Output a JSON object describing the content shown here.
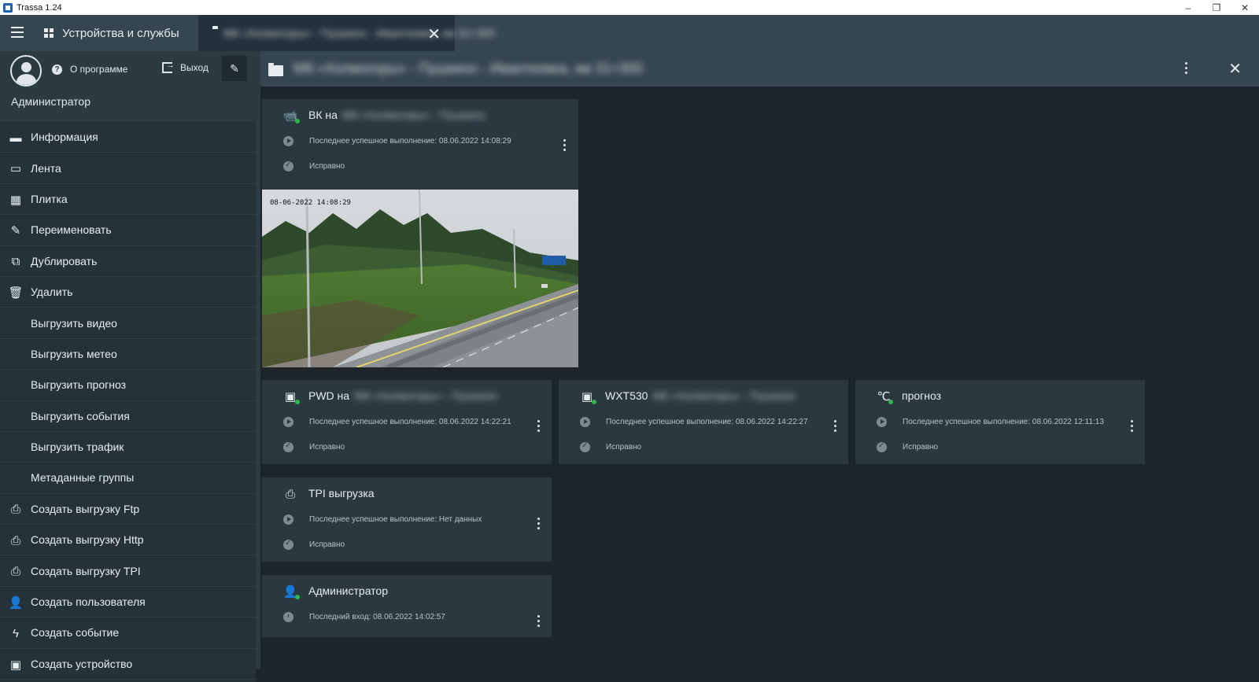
{
  "window": {
    "title": "Trassa 1.24",
    "controls": {
      "minimize": "–",
      "restore": "❐",
      "close": "✕"
    }
  },
  "tabs": {
    "menu_icon": "hamburger-icon",
    "devices_label": "Устройства и службы",
    "folder_label": "М8 «Холмогоры» - Пушкино - Ивантеевка, км 31+300",
    "close_glyph": "✕"
  },
  "sidebar": {
    "about_label": "О программе",
    "logout_label": "Выход",
    "pin_glyph": "✎",
    "username": "Администратор",
    "items": [
      {
        "label": "Информация",
        "icon": "folder-icon",
        "glyph": "▬"
      },
      {
        "label": "Лента",
        "icon": "list-icon",
        "glyph": "▭"
      },
      {
        "label": "Плитка",
        "icon": "tiles-icon",
        "glyph": "▦"
      },
      {
        "label": "Переименовать",
        "icon": "pencil-icon",
        "glyph": "✎"
      },
      {
        "label": "Дублировать",
        "icon": "duplicate-icon",
        "glyph": "⧉"
      },
      {
        "label": "Удалить",
        "icon": "trash-icon",
        "glyph": "🗑"
      },
      {
        "label": "Выгрузить видео",
        "icon": "",
        "glyph": ""
      },
      {
        "label": "Выгрузить метео",
        "icon": "",
        "glyph": ""
      },
      {
        "label": "Выгрузить прогноз",
        "icon": "",
        "glyph": ""
      },
      {
        "label": "Выгрузить события",
        "icon": "",
        "glyph": ""
      },
      {
        "label": "Выгрузить трафик",
        "icon": "",
        "glyph": ""
      },
      {
        "label": "Метаданные группы",
        "icon": "",
        "glyph": ""
      },
      {
        "label": "Создать выгрузку Ftp",
        "icon": "export-add-icon",
        "glyph": "⎙"
      },
      {
        "label": "Создать выгрузку Http",
        "icon": "export-add-icon",
        "glyph": "⎙"
      },
      {
        "label": "Создать выгрузку TPI",
        "icon": "export-add-icon",
        "glyph": "⎙"
      },
      {
        "label": "Создать пользователя",
        "icon": "user-add-icon",
        "glyph": "👤"
      },
      {
        "label": "Создать событие",
        "icon": "event-add-icon",
        "glyph": "ϟ"
      },
      {
        "label": "Создать устройство",
        "icon": "device-add-icon",
        "glyph": "▣"
      }
    ]
  },
  "content": {
    "header_title": "М8 «Холмогоры» - Пушкино - Ивантеевка, км 31+300",
    "cards": {
      "camera": {
        "title": "ВК на",
        "title_blurred": "М8 «Холмогоры» - Пушкино",
        "last_run": "Последнее успешное выполнение: 08.06.2022 14:08:29",
        "status": "Исправно",
        "image_timestamp": "08-06-2022 14:08:29"
      },
      "pwd": {
        "title": "PWD на",
        "title_blurred": "М8 «Холмогоры» - Пушкино",
        "last_run": "Последнее успешное выполнение: 08.06.2022 14:22:21",
        "status": "Исправно"
      },
      "wxt": {
        "title": "WXT530",
        "title_blurred": "М8 «Холмогоры» - Пушкино",
        "last_run": "Последнее успешное выполнение: 08.06.2022 14:22:27",
        "status": "Исправно"
      },
      "forecast": {
        "title": "прогноз",
        "last_run": "Последнее успешное выполнение: 08.06.2022 12:11:13",
        "status": "Исправно"
      },
      "tpi": {
        "title": "TPI выгрузка",
        "last_run": "Последнее успешное выполнение: Нет данных",
        "status": "Исправно"
      },
      "admin": {
        "title": "Администратор",
        "last_login": "Последний вход: 08.06.2022 14:02:57"
      }
    }
  },
  "colors": {
    "background": "#1d252b",
    "panel": "#26323a",
    "card": "#2b3840",
    "header": "#36464f",
    "online": "#2eb84a"
  }
}
